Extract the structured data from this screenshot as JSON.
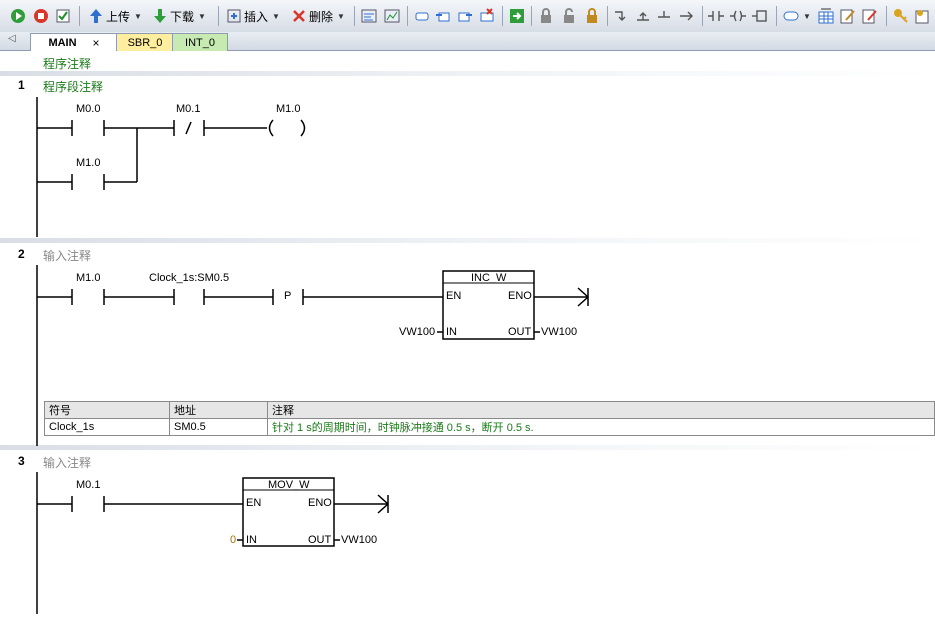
{
  "toolbar": {
    "upload_label": "上传",
    "download_label": "下载",
    "insert_label": "插入",
    "delete_label": "删除",
    "icons": [
      "run-icon",
      "stop-icon",
      "compile-icon",
      "upload-icon",
      "download-icon",
      "insert-icon",
      "delete-icon",
      "program-status-icon",
      "trend-icon",
      "zoom-icon",
      "network-icons",
      "lock-icon",
      "contact-icon",
      "coil-icon",
      "box-icon",
      "key-icon"
    ]
  },
  "tabs": [
    {
      "label": "MAIN",
      "active": true
    },
    {
      "label": "SBR_0",
      "active": false
    },
    {
      "label": "INT_0",
      "active": false
    }
  ],
  "program_comment": "程序注释",
  "networks": [
    {
      "number": "1",
      "comment": "程序段注释",
      "contacts": [
        {
          "label": "M0.0",
          "type": "NO"
        },
        {
          "label": "M0.1",
          "type": "NC"
        },
        {
          "label": "M1.0",
          "type": "NO"
        }
      ],
      "coil": {
        "label": "M1.0"
      }
    },
    {
      "number": "2",
      "comment": "输入注释",
      "contacts": [
        {
          "label": "M1.0",
          "type": "NO"
        },
        {
          "label": "Clock_1s:SM0.5",
          "type": "NO"
        }
      ],
      "edge": "P",
      "box": {
        "name": "INC_W",
        "en": "EN",
        "eno": "ENO",
        "in_pin": "IN",
        "out_pin": "OUT",
        "in_val": "VW100",
        "out_val": "VW100"
      },
      "symbol_table": {
        "headers": [
          "符号",
          "地址",
          "注释"
        ],
        "rows": [
          [
            "Clock_1s",
            "SM0.5",
            "针对 1 s的周期时间，时钟脉冲接通 0.5 s，断开 0.5 s."
          ]
        ]
      }
    },
    {
      "number": "3",
      "comment": "输入注释",
      "contacts": [
        {
          "label": "M0.1",
          "type": "NO"
        }
      ],
      "box": {
        "name": "MOV_W",
        "en": "EN",
        "eno": "ENO",
        "in_pin": "IN",
        "out_pin": "OUT",
        "in_val": "0",
        "out_val": "VW100"
      }
    }
  ]
}
